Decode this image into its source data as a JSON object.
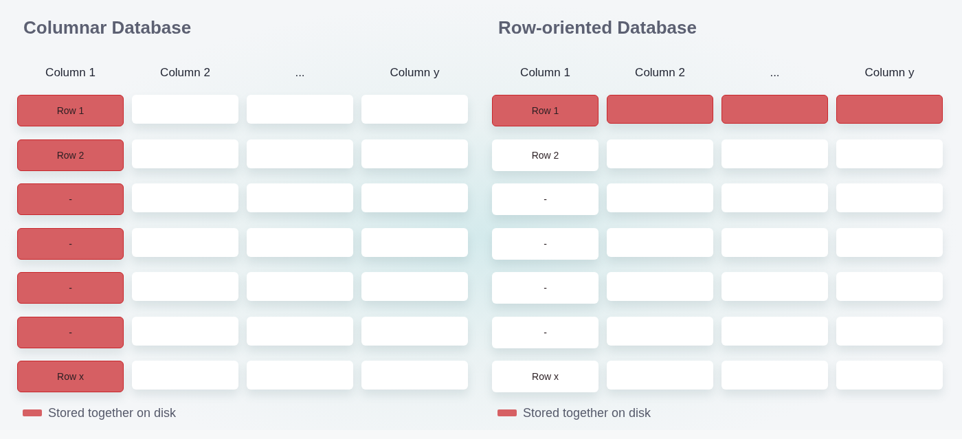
{
  "panels": [
    {
      "title": "Columnar Database",
      "columns": [
        "Column 1",
        "Column 2",
        "...",
        "Column y"
      ],
      "rows": [
        {
          "cells": [
            {
              "text": "Row 1",
              "highlighted": true
            },
            {
              "highlighted": false
            },
            {
              "highlighted": false
            },
            {
              "highlighted": false
            }
          ]
        },
        {
          "cells": [
            {
              "text": "Row 2",
              "highlighted": true
            },
            {
              "highlighted": false
            },
            {
              "highlighted": false
            },
            {
              "highlighted": false
            }
          ]
        },
        {
          "cells": [
            {
              "text": "-",
              "highlighted": true
            },
            {
              "highlighted": false
            },
            {
              "highlighted": false
            },
            {
              "highlighted": false
            }
          ]
        },
        {
          "cells": [
            {
              "text": "-",
              "highlighted": true
            },
            {
              "highlighted": false
            },
            {
              "highlighted": false
            },
            {
              "highlighted": false
            }
          ]
        },
        {
          "cells": [
            {
              "text": "-",
              "highlighted": true
            },
            {
              "highlighted": false
            },
            {
              "highlighted": false
            },
            {
              "highlighted": false
            }
          ]
        },
        {
          "cells": [
            {
              "text": "-",
              "highlighted": true
            },
            {
              "highlighted": false
            },
            {
              "highlighted": false
            },
            {
              "highlighted": false
            }
          ]
        },
        {
          "cells": [
            {
              "text": "Row x",
              "highlighted": true
            },
            {
              "highlighted": false
            },
            {
              "highlighted": false
            },
            {
              "highlighted": false
            }
          ]
        }
      ],
      "legend": {
        "label": "Stored together on disk",
        "color": "#d66064"
      }
    },
    {
      "title": "Row-oriented Database",
      "columns": [
        "Column 1",
        "Column 2",
        "...",
        "Column y"
      ],
      "rows": [
        {
          "cells": [
            {
              "text": "Row 1",
              "highlighted": true
            },
            {
              "highlighted": true
            },
            {
              "highlighted": true
            },
            {
              "highlighted": true
            }
          ]
        },
        {
          "cells": [
            {
              "text": "Row 2",
              "highlighted": false
            },
            {
              "highlighted": false
            },
            {
              "highlighted": false
            },
            {
              "highlighted": false
            }
          ]
        },
        {
          "cells": [
            {
              "text": "-",
              "highlighted": false
            },
            {
              "highlighted": false
            },
            {
              "highlighted": false
            },
            {
              "highlighted": false
            }
          ]
        },
        {
          "cells": [
            {
              "text": "-",
              "highlighted": false
            },
            {
              "highlighted": false
            },
            {
              "highlighted": false
            },
            {
              "highlighted": false
            }
          ]
        },
        {
          "cells": [
            {
              "text": "-",
              "highlighted": false
            },
            {
              "highlighted": false
            },
            {
              "highlighted": false
            },
            {
              "highlighted": false
            }
          ]
        },
        {
          "cells": [
            {
              "text": "-",
              "highlighted": false
            },
            {
              "highlighted": false
            },
            {
              "highlighted": false
            },
            {
              "highlighted": false
            }
          ]
        },
        {
          "cells": [
            {
              "text": "Row x",
              "highlighted": false
            },
            {
              "highlighted": false
            },
            {
              "highlighted": false
            },
            {
              "highlighted": false
            }
          ]
        }
      ],
      "legend": {
        "label": "Stored together on disk",
        "color": "#d66064"
      }
    }
  ]
}
